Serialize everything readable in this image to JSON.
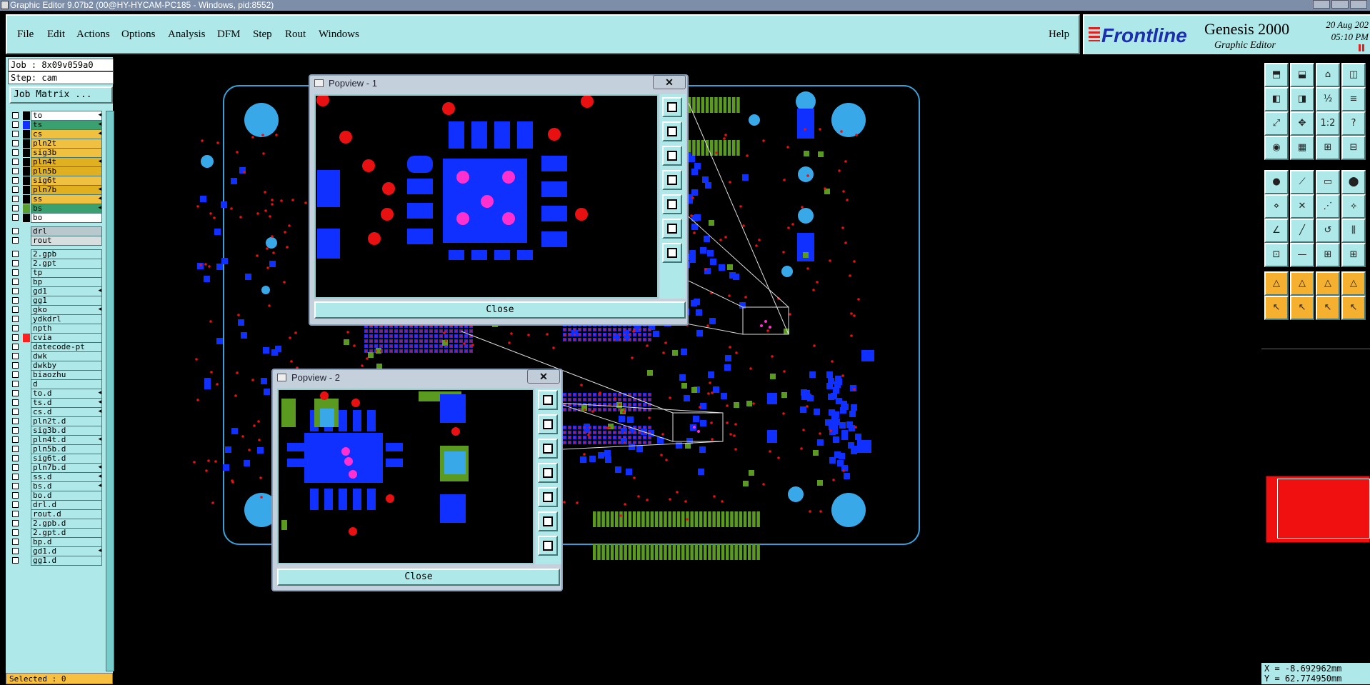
{
  "window": {
    "title": "Graphic Editor 9.07b2 (00@HY-HYCAM-PC185 - Windows, pid:8552)"
  },
  "menu": {
    "items": [
      "File",
      "Edit",
      "Actions",
      "Options",
      "Analysis",
      "DFM",
      "Step",
      "Rout",
      "Windows"
    ],
    "help": "Help"
  },
  "brand": {
    "logo": "Frontline",
    "product": "Genesis 2000",
    "subtitle": "Graphic Editor",
    "date": "20 Aug 202",
    "time": "05:10 PM"
  },
  "left_panel": {
    "job": "Job : 8x09v059a0",
    "step": "Step: cam",
    "job_matrix_button": "Job Matrix ..."
  },
  "layers": [
    {
      "name": "to",
      "color": "#ffffff",
      "swatch": "#000000",
      "arrow": true
    },
    {
      "name": "ts",
      "color": "#3aa070",
      "swatch": "#1030ff",
      "arrow": true
    },
    {
      "name": "cs",
      "color": "#f0c040",
      "swatch": "#000000",
      "arrow": true
    },
    {
      "name": "pln2t",
      "color": "#f0c040",
      "swatch": "#000000",
      "arrow": false
    },
    {
      "name": "sig3b",
      "color": "#f0c040",
      "swatch": "#000000",
      "arrow": false
    },
    {
      "name": "pln4t",
      "color": "#e0b020",
      "swatch": "#000000",
      "arrow": true
    },
    {
      "name": "pln5b",
      "color": "#e0b020",
      "swatch": "#000000",
      "arrow": false
    },
    {
      "name": "sig6t",
      "color": "#f0c040",
      "swatch": "#000000",
      "arrow": false
    },
    {
      "name": "pln7b",
      "color": "#e0b020",
      "swatch": "#000000",
      "arrow": true
    },
    {
      "name": "ss",
      "color": "#f0c040",
      "swatch": "#000000",
      "arrow": true
    },
    {
      "name": "bs",
      "color": "#3aa070",
      "swatch": "#5aa030",
      "arrow": true
    },
    {
      "name": "bo",
      "color": "#ffffff",
      "swatch": "#000000",
      "arrow": false
    },
    {
      "name": "drl",
      "color": "#b8c8cc",
      "swatch": "#aee8e8",
      "arrow": false
    },
    {
      "name": "rout",
      "color": "#d8dede",
      "swatch": "#aee8e8",
      "arrow": false
    },
    {
      "name": "2.gpb",
      "color": "#aee8e8",
      "swatch": "#aee8e8",
      "arrow": false
    },
    {
      "name": "2.gpt",
      "color": "#aee8e8",
      "swatch": "#aee8e8",
      "arrow": false
    },
    {
      "name": "tp",
      "color": "#aee8e8",
      "swatch": "#aee8e8",
      "arrow": false
    },
    {
      "name": "bp",
      "color": "#aee8e8",
      "swatch": "#aee8e8",
      "arrow": false
    },
    {
      "name": "gd1",
      "color": "#aee8e8",
      "swatch": "#aee8e8",
      "arrow": true
    },
    {
      "name": "gg1",
      "color": "#aee8e8",
      "swatch": "#aee8e8",
      "arrow": false
    },
    {
      "name": "gko",
      "color": "#aee8e8",
      "swatch": "#aee8e8",
      "arrow": true
    },
    {
      "name": "ydkdrl",
      "color": "#aee8e8",
      "swatch": "#aee8e8",
      "arrow": false
    },
    {
      "name": "npth",
      "color": "#aee8e8",
      "swatch": "#aee8e8",
      "arrow": false
    },
    {
      "name": "cvia",
      "color": "#aee8e8",
      "swatch": "#ff2020",
      "arrow": false
    },
    {
      "name": "datecode-pt",
      "color": "#aee8e8",
      "swatch": "#aee8e8",
      "arrow": false
    },
    {
      "name": "dwk",
      "color": "#aee8e8",
      "swatch": "#aee8e8",
      "arrow": false
    },
    {
      "name": "dwkby",
      "color": "#aee8e8",
      "swatch": "#aee8e8",
      "arrow": false
    },
    {
      "name": "biaozhu",
      "color": "#aee8e8",
      "swatch": "#aee8e8",
      "arrow": false
    },
    {
      "name": "d",
      "color": "#aee8e8",
      "swatch": "#aee8e8",
      "arrow": false
    },
    {
      "name": "to.d",
      "color": "#aee8e8",
      "swatch": "#aee8e8",
      "arrow": true
    },
    {
      "name": "ts.d",
      "color": "#aee8e8",
      "swatch": "#aee8e8",
      "arrow": true
    },
    {
      "name": "cs.d",
      "color": "#aee8e8",
      "swatch": "#aee8e8",
      "arrow": true
    },
    {
      "name": "pln2t.d",
      "color": "#aee8e8",
      "swatch": "#aee8e8",
      "arrow": false
    },
    {
      "name": "sig3b.d",
      "color": "#aee8e8",
      "swatch": "#aee8e8",
      "arrow": false
    },
    {
      "name": "pln4t.d",
      "color": "#aee8e8",
      "swatch": "#aee8e8",
      "arrow": true
    },
    {
      "name": "pln5b.d",
      "color": "#aee8e8",
      "swatch": "#aee8e8",
      "arrow": false
    },
    {
      "name": "sig6t.d",
      "color": "#aee8e8",
      "swatch": "#aee8e8",
      "arrow": false
    },
    {
      "name": "pln7b.d",
      "color": "#aee8e8",
      "swatch": "#aee8e8",
      "arrow": true
    },
    {
      "name": "ss.d",
      "color": "#aee8e8",
      "swatch": "#aee8e8",
      "arrow": true
    },
    {
      "name": "bs.d",
      "color": "#aee8e8",
      "swatch": "#aee8e8",
      "arrow": true
    },
    {
      "name": "bo.d",
      "color": "#aee8e8",
      "swatch": "#aee8e8",
      "arrow": false
    },
    {
      "name": "drl.d",
      "color": "#aee8e8",
      "swatch": "#aee8e8",
      "arrow": false
    },
    {
      "name": "rout.d",
      "color": "#aee8e8",
      "swatch": "#aee8e8",
      "arrow": false
    },
    {
      "name": "2.gpb.d",
      "color": "#aee8e8",
      "swatch": "#aee8e8",
      "arrow": false
    },
    {
      "name": "2.gpt.d",
      "color": "#aee8e8",
      "swatch": "#aee8e8",
      "arrow": false
    },
    {
      "name": "bp.d",
      "color": "#aee8e8",
      "swatch": "#aee8e8",
      "arrow": false
    },
    {
      "name": "gd1.d",
      "color": "#aee8e8",
      "swatch": "#aee8e8",
      "arrow": true
    },
    {
      "name": "gg1.d",
      "color": "#aee8e8",
      "swatch": "#aee8e8",
      "arrow": false
    }
  ],
  "status": {
    "selected": "Selected : 0"
  },
  "coords": {
    "x": "X = -8.692962mm",
    "y": "Y = 62.774950mm"
  },
  "popview1": {
    "title": "Popview - 1",
    "close_label": "Close"
  },
  "popview2": {
    "title": "Popview - 2",
    "close_label": "Close"
  },
  "colors": {
    "board_outline": "#3a9fd6",
    "pad_blue": "#1030ff",
    "pad_green": "#5a9a20",
    "via_red": "#e81010",
    "hole_cyan": "#38a8e8",
    "highlight_magenta": "#ff30d0",
    "panel": "#aee8e8"
  },
  "toolbox": {
    "icons": [
      "zoom-home-icon",
      "zoom-fit-icon",
      "home-icon",
      "window-icon",
      "left-icon",
      "right-icon",
      "half-icon",
      "step-icon",
      "fit-icon",
      "center-icon",
      "scale-icon",
      "help-icon",
      "measure-icon",
      "grid-icon",
      "snap-icon",
      "net-icon",
      "pad-add-icon",
      "line-add-icon",
      "ruler-icon",
      "circle-icon",
      "node-icon",
      "cross-icon",
      "dot-line-icon",
      "arc-icon",
      "angle-icon",
      "slash-icon",
      "curve-icon",
      "chart-icon",
      "move-icon",
      "line-icon",
      "box-icon",
      "bus-icon",
      "tri-icon",
      "tri2-icon",
      "tri3-icon",
      "tri4-icon",
      "select-icon",
      "select2-icon",
      "select3-icon",
      "select4-icon"
    ],
    "glyphs": [
      "⬒",
      "⬓",
      "⌂",
      "◫",
      "◧",
      "◨",
      "½",
      "≡",
      "⤢",
      "✥",
      "1:2",
      "?",
      "◉",
      "▦",
      "⊞",
      "⊟",
      "●",
      "⟋",
      "▭",
      "⬤",
      "⋄",
      "✕",
      "⋰",
      "⟡",
      "∠",
      "╱",
      "↺",
      "⫼",
      "⊡",
      "—",
      "⊞",
      "⊞",
      "△",
      "△",
      "△",
      "△",
      "↖",
      "↖",
      "↖",
      "↖"
    ]
  },
  "popview_tools": [
    "zoom-window-icon",
    "zoom-in-icon",
    "zoom-out-icon",
    "pan-left-icon",
    "pan-right-icon",
    "zoom-home-icon",
    "zoom-fit-icon"
  ]
}
